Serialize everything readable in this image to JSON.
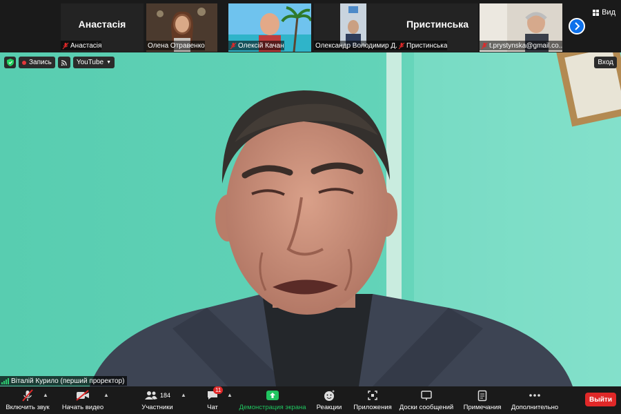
{
  "gallery": {
    "tiles": [
      {
        "big_name": "Анастасія",
        "caption": "Анастасія",
        "muted": true
      },
      {
        "big_name": "",
        "caption": "Олена Отравенко",
        "muted": false
      },
      {
        "big_name": "",
        "caption": "Олексій Качан",
        "muted": true
      },
      {
        "big_name": "",
        "caption": "Олександр Володимир Д...",
        "muted": false
      },
      {
        "big_name": "Пристинська",
        "caption": "Пристинська",
        "muted": true
      },
      {
        "big_name": "",
        "caption": "t.prystynska@gmail.co...",
        "muted": true
      }
    ],
    "view_label": "Вид"
  },
  "main": {
    "record_label": "Запись",
    "youtube_label": "YouTube",
    "exit_label": "Вход",
    "speaker_name": "Віталій Курило (перший проректор)"
  },
  "toolbar": {
    "audio_label": "Включить звук",
    "video_label": "Начать видео",
    "participants_label": "Участники",
    "participants_count": "184",
    "chat_label": "Чат",
    "chat_badge": "11",
    "share_label": "Демонстрация экрана",
    "reactions_label": "Реакции",
    "apps_label": "Приложения",
    "whiteboard_label": "Доски сообщений",
    "notes_label": "Примечания",
    "more_label": "Дополнительно",
    "leave_label": "Выйти"
  },
  "colors": {
    "accent_blue": "#0e71eb",
    "leave_red": "#e02828",
    "share_green": "#20c560",
    "background_wall": "#5fd0b4"
  }
}
